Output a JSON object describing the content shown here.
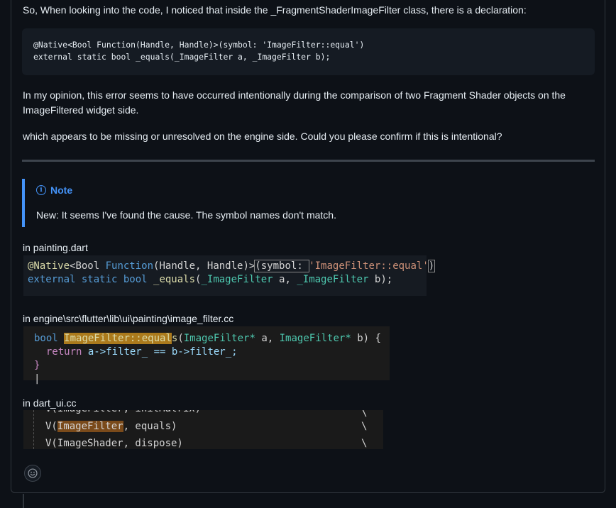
{
  "comment": {
    "para1": "So, When looking into the code, I noticed that inside the _FragmentShaderImageFilter class, there is a declaration:",
    "code_line1": "@Native<Bool Function(Handle, Handle)>(symbol: 'ImageFilter::equal')",
    "code_line2": "external static bool _equals(_ImageFilter a, _ImageFilter b);",
    "para2_line1": "In my opinion, this error seems to have occurred intentionally during the comparison of two Fragment Shader objects on the",
    "para2_line2": "ImageFiltered widget side.",
    "para3": "which appears to be missing or unresolved on the engine side. Could you please confirm if this is intentional?",
    "note_title": "Note",
    "note_body": "New: It seems I've found the cause. The symbol names don't match.",
    "label1": "in painting.dart",
    "label2": "in engine\\src\\flutter\\lib\\ui\\painting\\image_filter.cc",
    "label3": "in dart_ui.cc"
  },
  "screenshot1": {
    "l1_a": "@Native",
    "l1_b": "<Bool ",
    "l1_c": "Function",
    "l1_d": "(Handle, Handle)>",
    "l1_e": "(symbol: ",
    "l1_f": "'ImageFilter::equal'",
    "l1_g": ")",
    "l2_a": "external static bool ",
    "l2_b": "_equals",
    "l2_c": "(",
    "l2_d": "_ImageFilter",
    "l2_e": " a, ",
    "l2_f": "_ImageFilter",
    "l2_g": " b);"
  },
  "screenshot2": {
    "l1_a": "bool ",
    "l1_b": "ImageFilter::equal",
    "l1_c": "s",
    "l1_d": "(",
    "l1_e": "ImageFilter*",
    "l1_f": " a, ",
    "l1_g": "ImageFilter*",
    "l1_h": " b) {",
    "l2_a": "return ",
    "l2_b": "a->filter_ == b->filter_;",
    "l3": "}",
    "l4": "|"
  },
  "screenshot3": {
    "l0": "V(ImageFilter, initMatrix)",
    "l1_a": "V(",
    "l1_b": "ImageFilter",
    "l1_c": ", equals)",
    "l2": "V(ImageShader, dispose)",
    "bs": "\\"
  },
  "icons": {
    "note": "info-icon",
    "reaction": "smiley-icon"
  },
  "colors": {
    "accent": "#4493f8",
    "background": "#0d1117"
  }
}
